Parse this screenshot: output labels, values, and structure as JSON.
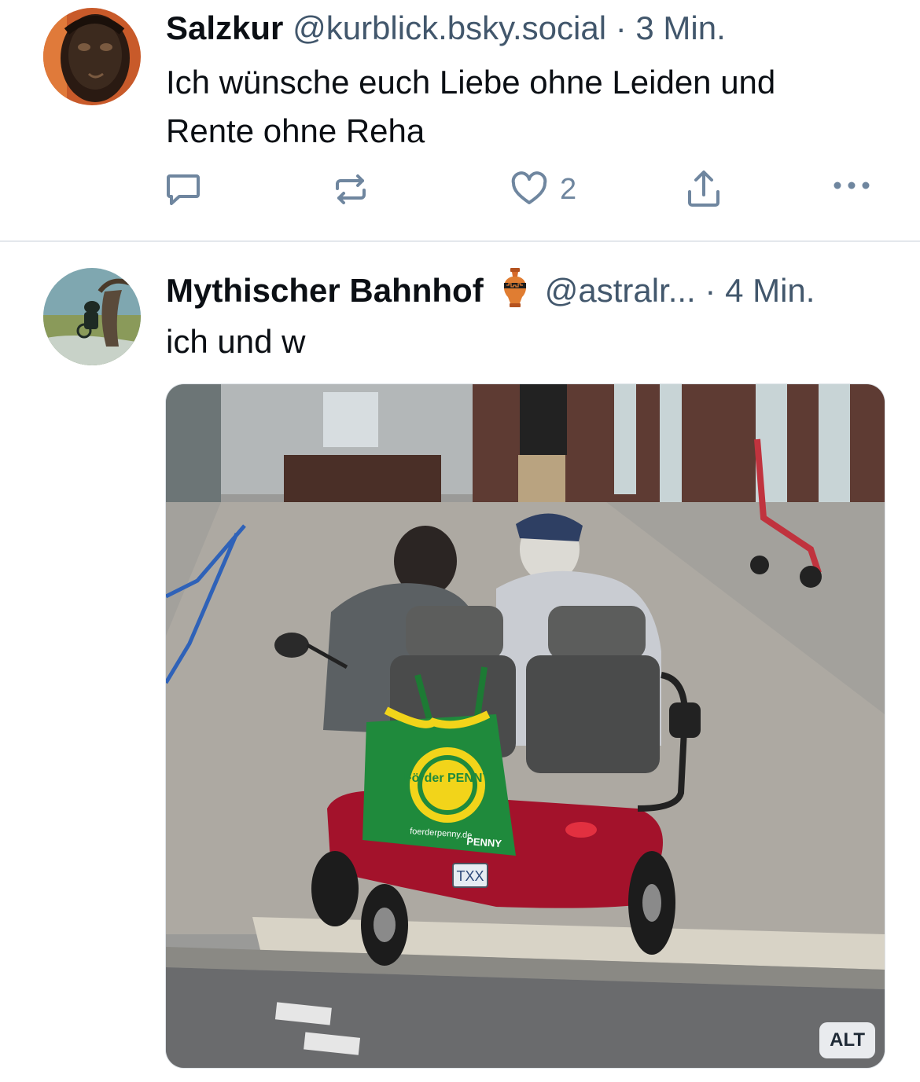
{
  "posts": [
    {
      "author_name": "Salzkur",
      "handle": "@kurblick.bsky.social",
      "separator": "·",
      "time": "3 Min.",
      "text_line1": "Ich wünsche euch Liebe ohne Leiden und",
      "text_line2": "Rente ohne Reha",
      "like_count": "2"
    },
    {
      "author_name": "Mythischer Bahnhof",
      "name_emoji": "amphora",
      "handle": "@astralr...",
      "separator": "·",
      "time": "4 Min.",
      "text": "ich und w",
      "image_alt_badge": "ALT",
      "image_text": {
        "bag_logo": "Förder PENNY",
        "bag_url": "foerderpenny.de",
        "bag_brand": "PENNY",
        "plate": "TXX"
      }
    }
  ],
  "icons": [
    "reply-icon",
    "repost-icon",
    "like-icon",
    "share-icon",
    "more-icon"
  ],
  "colors": {
    "text": "#0b0f14",
    "muted": "#42576c",
    "icon": "#6f869f",
    "divider": "#e4e8ec",
    "scooter_red": "#a3122b",
    "bag_green": "#1f8a3c"
  }
}
